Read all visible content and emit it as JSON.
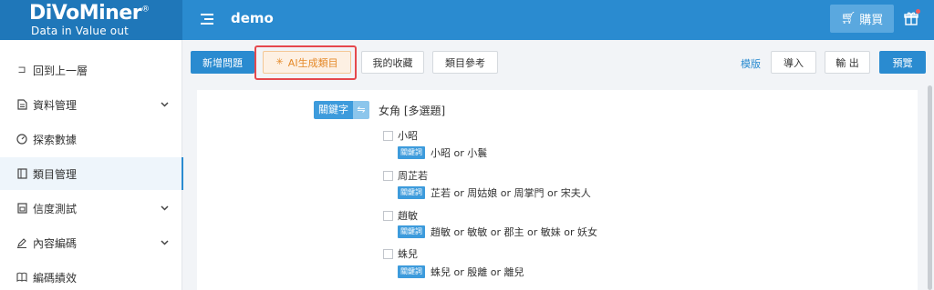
{
  "app": {
    "logo_name": "DiVoMiner",
    "logo_reg": "®",
    "logo_tagline": "Data in  Value out",
    "project_name": "demo",
    "buy_label": "購買"
  },
  "sidebar": {
    "items": [
      {
        "label": "回到上一層",
        "icon": "back-icon",
        "chevron": false,
        "active": false
      },
      {
        "label": "資料管理",
        "icon": "document-icon",
        "chevron": true,
        "active": false
      },
      {
        "label": "探索數據",
        "icon": "gauge-icon",
        "chevron": false,
        "active": false
      },
      {
        "label": "類目管理",
        "icon": "category-icon",
        "chevron": false,
        "active": true
      },
      {
        "label": "信度測試",
        "icon": "test-icon",
        "chevron": true,
        "active": false
      },
      {
        "label": "內容編碼",
        "icon": "pen-icon",
        "chevron": true,
        "active": false
      },
      {
        "label": "編碼績效",
        "icon": "book-icon",
        "chevron": false,
        "active": false
      }
    ]
  },
  "toolbar": {
    "new_question": "新增問題",
    "ai_generate": "AI生成類目",
    "my_favorites": "我的收藏",
    "category_reference": "類目參考",
    "template": "模版",
    "import": "導入",
    "export": "輸 出",
    "preview": "預覽"
  },
  "question": {
    "tag": "關鍵字",
    "swap_symbol": "⇋",
    "title": "女角 [多選題]",
    "options": [
      {
        "label": "小昭",
        "badge": "關鍵詞",
        "keywords": "小昭 or 小鬟"
      },
      {
        "label": "周芷若",
        "badge": "關鍵詞",
        "keywords": "芷若 or 周姑娘 or 周掌門 or 宋夫人"
      },
      {
        "label": "趙敏",
        "badge": "關鍵詞",
        "keywords": "趙敏 or 敏敏 or 郡主 or 敏妹 or 妖女"
      },
      {
        "label": "蛛兒",
        "badge": "關鍵詞",
        "keywords": "蛛兒 or 殷離 or 離兒"
      }
    ]
  },
  "colors": {
    "header": "#2a8bd0",
    "logo_bg": "#1f77b9",
    "accent": "#2a8bd0",
    "ai_button": "#e58a2a",
    "highlight": "#e5484d"
  }
}
